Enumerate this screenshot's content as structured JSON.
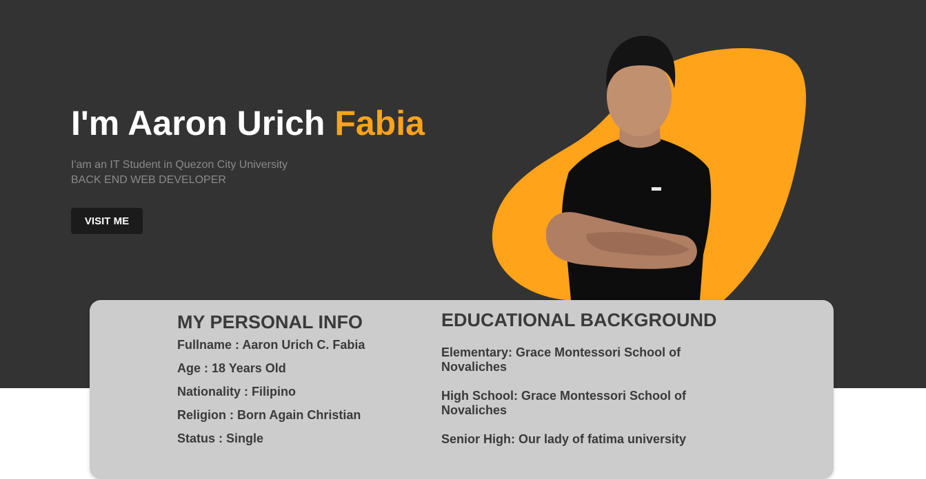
{
  "hero": {
    "title_prefix": "I'm Aaron Urich ",
    "title_accent": "Fabia",
    "subtitle_line1": "I'am an IT Student in Quezon City University",
    "subtitle_line2": "BACK END WEB DEVELOPER",
    "button_label": "VISIT ME"
  },
  "personal_info": {
    "title": "MY PERSONAL INFO",
    "items": [
      "Fullname : Aaron Urich C. Fabia",
      "Age : 18 Years Old",
      "Nationality : Filipino",
      "Religion : Born Again Christian",
      "Status : Single"
    ]
  },
  "education": {
    "title": "EDUCATIONAL BACKGROUND",
    "items": [
      "Elementary: Grace Montessori School of Novaliches",
      "High School: Grace Montessori School of Novaliches",
      "Senior High: Our lady of fatima university"
    ]
  },
  "colors": {
    "hero_bg": "#333333",
    "accent": "#ffa31a",
    "card_bg": "#cccccc",
    "button_bg": "#1b1b1b"
  }
}
